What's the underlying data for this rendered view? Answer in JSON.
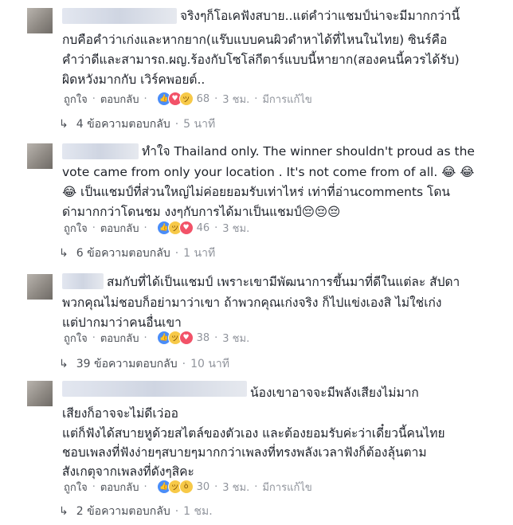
{
  "actions": {
    "like": "ถูกใจ",
    "reply": "ตอบกลับ"
  },
  "comments": [
    {
      "lines": [
        "จริงๆก็โอเคฟังสบาย..แต่คำว่าแชมป์น่าจะมีมากกว่านี้",
        "กบคือคำว่าเก่งและหากยาก(แร๊บแบบคนผิวดำหาได้ที่ไหนในไทย) ซินร์คือ",
        "คำว่าดีและสามารถ.ผญ.ร้องกับโซโล่กีตาร์แบบนี้หายาก(สองคนนี้ควรได้รับ)",
        "ผิดหวังมากกับ เวิร์คพอยต์.."
      ],
      "reaction_count": "68",
      "time": "3 ชม.",
      "edited": "มีการแก้ไข",
      "replies_label": "4 ข้อความตอบกลับ",
      "replies_time": "5 นาที"
    },
    {
      "lines": [
        "ทำใจ Thailand only. The winner shouldn't proud as the",
        "vote came from only your location . It's not come from of all. 😂 😂",
        "😂 เป็นแชมป์ที่ส่วนใหญ่ไม่ค่อยยอมรับเท่าไหร่ เท่าที่อ่านcomments โดน",
        "ด่ามากกว่าโดนชม งงๆกับการได้มาเป็นแชมป์😔😔😔"
      ],
      "reaction_count": "46",
      "time": "3 ชม.",
      "replies_label": "6 ข้อความตอบกลับ",
      "replies_time": "1 นาที"
    },
    {
      "lines": [
        "สมกับที่ได้เป็นแชมป์ เพราะเขามีพัฒนาการขึ้นมาที่ดีในแต่ละ สัปดา",
        "พวกคุณไม่ชอบก็อย่ามาว่าเขา ถ้าพวกคุณเก่งจริง ก็ไปแข่งเองสิ ไม่ใช่เก่ง",
        "แต่ปากมาว่าคนอื่นเขา"
      ],
      "reaction_count": "38",
      "time": "3 ชม.",
      "replies_label": "39 ข้อความตอบกลับ",
      "replies_time": "10 นาที"
    },
    {
      "lines": [
        "น้องเขาอาจจะมีพลังเสียงไม่มาก",
        "เสียงก็อาจจะไม่ดีเว่ออ",
        "แต่ก็ฟังได้สบายหูด้วยสไตล์ของตัวเอง และต้องยอมรับค่ะว่าเดี๋ยวนี้คนไทย",
        "ชอบเพลงที่ฟังง่ายๆสบายๆมากกว่าเพลงที่ทรงพลังเวลาฟังก็ต้องลุ้นตาม",
        "สังเกตุจากเพลงที่ดังๆสิคะ"
      ],
      "reaction_count": "30",
      "time": "3 ชม.",
      "edited": "มีการแก้ไข",
      "replies_label": "2 ข้อความตอบกลับ",
      "replies_time": "1 ชม."
    }
  ],
  "colors": {
    "link": "#4b4f56",
    "meta": "#90949c",
    "text": "#1d2129",
    "like": "#4a8df8",
    "love": "#f25268",
    "haha": "#f7c948"
  }
}
